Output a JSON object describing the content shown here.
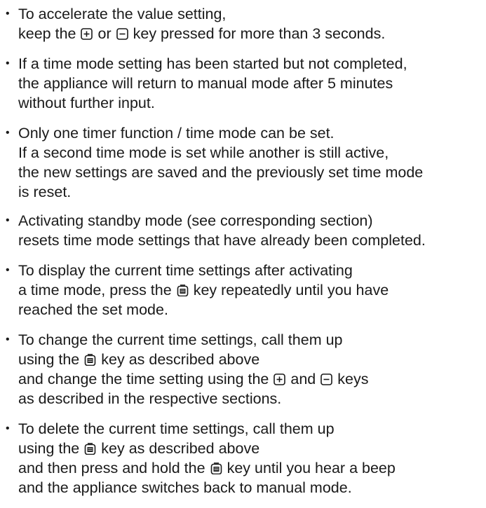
{
  "icons": {
    "plus": "plus-key-icon",
    "minus": "minus-key-icon",
    "menu": "menu-key-icon"
  },
  "bullet": "•",
  "notes": [
    {
      "lines": [
        [
          "To accelerate the value setting,"
        ],
        [
          "keep the",
          "plus",
          "or",
          "minus",
          "key pressed for more than 3 seconds."
        ]
      ]
    },
    {
      "lines": [
        [
          "If a time mode setting has been started but not completed,"
        ],
        [
          "the appliance will return to manual mode after 5 minutes"
        ],
        [
          "without further input."
        ]
      ]
    },
    {
      "lines": [
        [
          "Only one timer function / time mode can be set."
        ],
        [
          "If a second time mode is set while another is still active,"
        ],
        [
          "the new settings are saved and the previously set time mode"
        ],
        [
          "is reset."
        ]
      ]
    },
    {
      "lines": [
        [
          "Activating standby mode (see corresponding section)"
        ],
        [
          "resets time mode settings that have already been completed."
        ]
      ]
    },
    {
      "lines": [
        [
          "To display the current time settings after activating"
        ],
        [
          "a time mode, press the",
          "menu",
          "key repeatedly until you have"
        ],
        [
          "reached the set mode."
        ]
      ]
    },
    {
      "lines": [
        [
          "To change the current time settings, call them up"
        ],
        [
          "using the",
          "menu",
          "key as described above"
        ],
        [
          "and change the time setting using the",
          "plus",
          "and",
          "minus",
          "keys"
        ],
        [
          "as described in the respective sections."
        ]
      ]
    },
    {
      "lines": [
        [
          "To delete the current time settings, call them up"
        ],
        [
          "using the",
          "menu",
          "key as described above"
        ],
        [
          "and then press and hold the",
          "menu",
          "key until you hear a beep"
        ],
        [
          "and the appliance switches back to manual mode."
        ]
      ]
    }
  ]
}
